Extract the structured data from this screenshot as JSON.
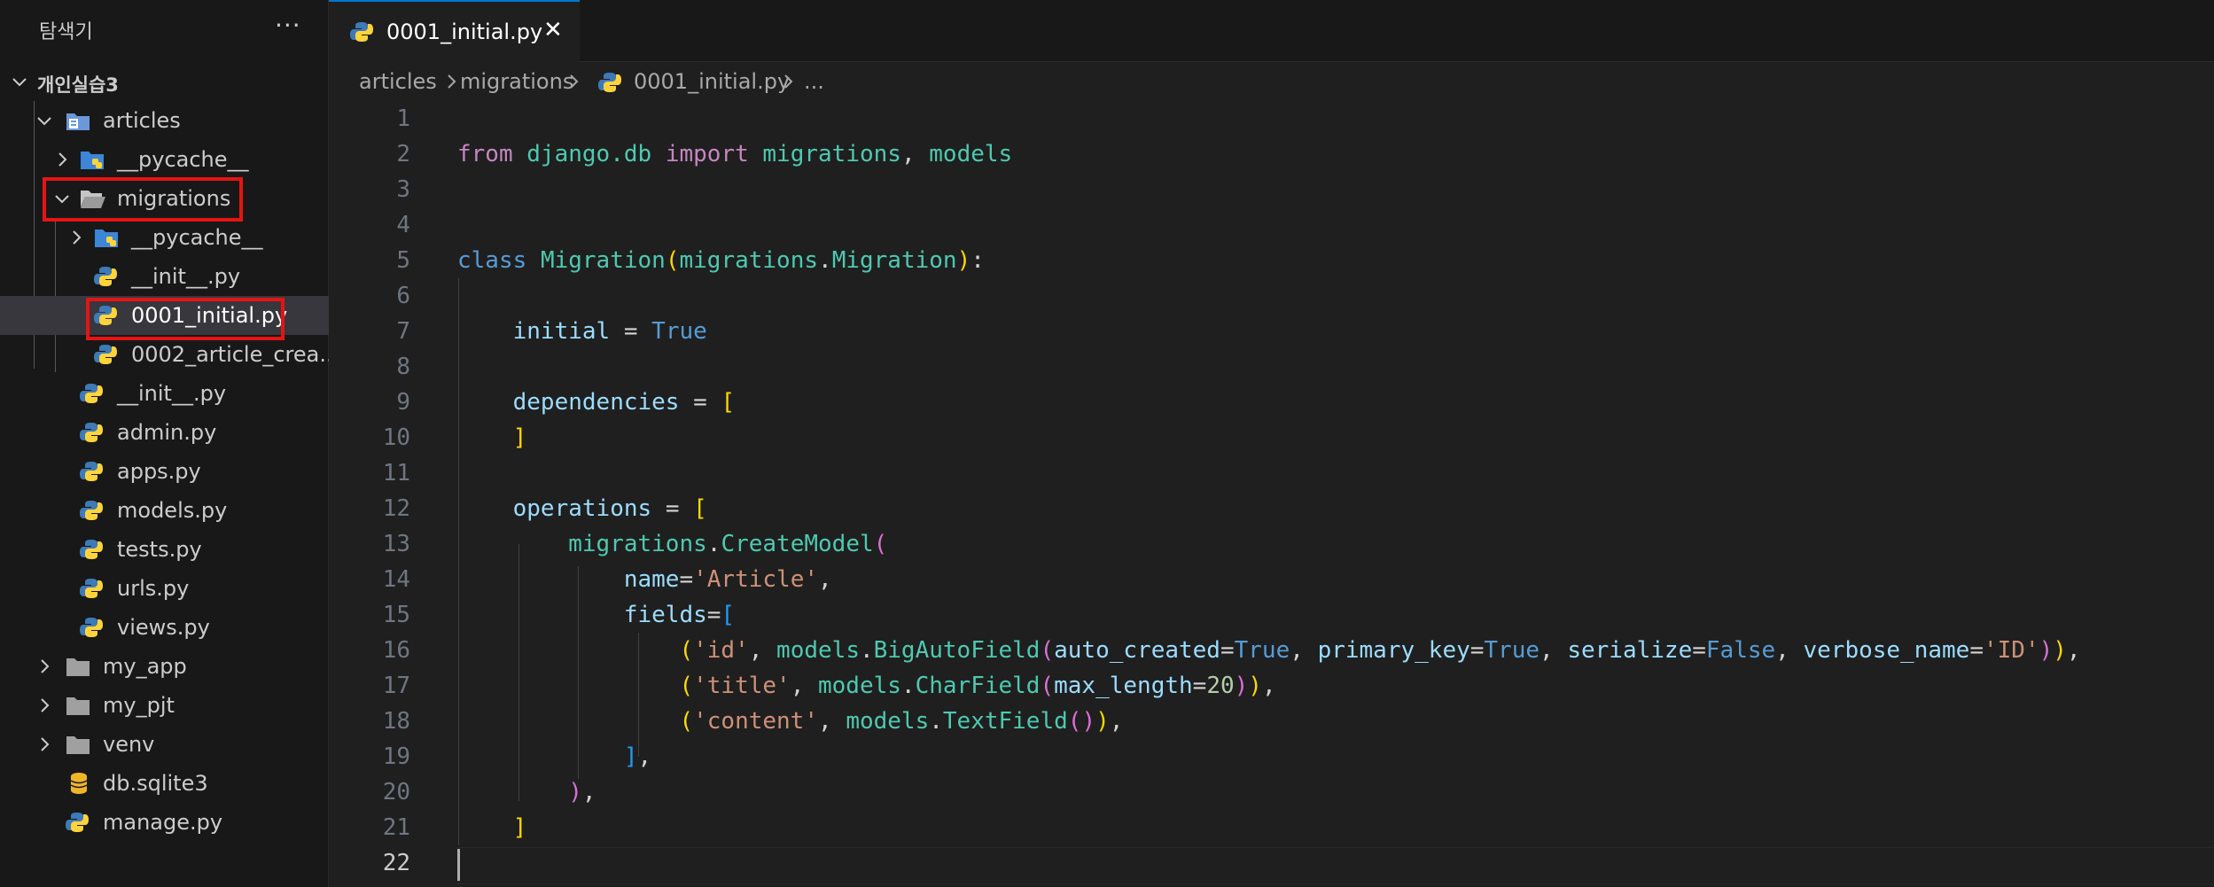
{
  "explorer": {
    "title": "탐색기",
    "more_label": "···",
    "tree": [
      {
        "label": "개인실습3"
      },
      {
        "label": "articles"
      },
      {
        "label": "__pycache__"
      },
      {
        "label": "migrations"
      },
      {
        "label": "__pycache__"
      },
      {
        "label": "__init__.py"
      },
      {
        "label": "0001_initial.py"
      },
      {
        "label": "0002_article_crea..."
      },
      {
        "label": "__init__.py"
      },
      {
        "label": "admin.py"
      },
      {
        "label": "apps.py"
      },
      {
        "label": "models.py"
      },
      {
        "label": "tests.py"
      },
      {
        "label": "urls.py"
      },
      {
        "label": "views.py"
      },
      {
        "label": "my_app"
      },
      {
        "label": "my_pjt"
      },
      {
        "label": "venv"
      },
      {
        "label": "db.sqlite3"
      },
      {
        "label": "manage.py"
      }
    ]
  },
  "editor": {
    "tab_label": "0001_initial.py",
    "tab_close": "✕",
    "breadcrumb": [
      "articles",
      "migrations",
      "0001_initial.py",
      "..."
    ],
    "line_numbers": [
      "1",
      "2",
      "3",
      "4",
      "5",
      "6",
      "7",
      "8",
      "9",
      "10",
      "11",
      "12",
      "13",
      "14",
      "15",
      "16",
      "17",
      "18",
      "19",
      "20",
      "21",
      "22"
    ],
    "tokens": {
      "from": "from",
      "django_db": "django.db",
      "import": "import",
      "migrations": "migrations",
      "comma_sp": ", ",
      "models": "models",
      "class": "class",
      "Migration": "Migration",
      "paren_open": "(",
      "dot": ".",
      "paren_close": ")",
      "colon": ":",
      "initial": "initial",
      "eq": " = ",
      "True": "True",
      "dependencies": "dependencies",
      "bracket_open": "[",
      "bracket_close": "]",
      "operations": "operations",
      "CreateModel": "CreateModel",
      "name": "name",
      "eq_tight": "=",
      "article_str": "'Article'",
      "comma": ",",
      "fields": "fields",
      "id_str": "'id'",
      "BigAutoField": "BigAutoField",
      "auto_created": "auto_created",
      "primary_key": "primary_key",
      "serialize": "serialize",
      "False": "False",
      "verbose_name": "verbose_name",
      "ID_str": "'ID'",
      "title_str": "'title'",
      "CharField": "CharField",
      "max_length": "max_length",
      "twenty": "20",
      "content_str": "'content'",
      "TextField": "TextField"
    }
  },
  "colors": {
    "accent": "#0078d4",
    "highlight": "#e51414",
    "keyword": "#c586c0",
    "class": "#4ec9b0",
    "string": "#ce9178"
  }
}
